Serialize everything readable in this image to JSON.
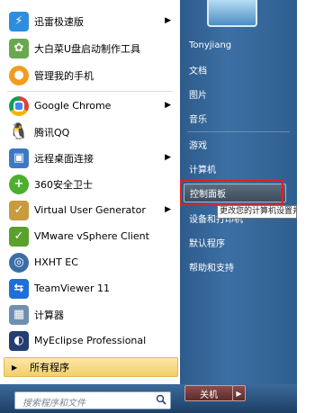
{
  "programs": [
    {
      "label": "迅雷极速版",
      "icon": "thunder-icon",
      "color": "#2e8de0",
      "arrow": true
    },
    {
      "label": "大白菜U盘启动制作工具",
      "icon": "cabbage-icon",
      "color": "#6aa84f",
      "arrow": false
    },
    {
      "label": "管理我的手机",
      "icon": "phone-manager-icon",
      "color": "#f29b1d",
      "arrow": false
    },
    {
      "label": "Google Chrome",
      "icon": "chrome-icon",
      "color": "#db4437",
      "arrow": true
    },
    {
      "label": "腾讯QQ",
      "icon": "qq-penguin-icon",
      "color": "#222222",
      "arrow": false
    },
    {
      "label": "远程桌面连接",
      "icon": "remote-desktop-icon",
      "color": "#3d78c4",
      "arrow": true
    },
    {
      "label": "360安全卫士",
      "icon": "360-icon",
      "color": "#4caf2e",
      "arrow": false
    },
    {
      "label": "Virtual User Generator",
      "icon": "vugen-icon",
      "color": "#c89b3c",
      "arrow": true
    },
    {
      "label": "VMware vSphere Client",
      "icon": "vmware-icon",
      "color": "#5aa02c",
      "arrow": false
    },
    {
      "label": "HXHT EC",
      "icon": "hxht-icon",
      "color": "#3a6ea5",
      "arrow": false
    },
    {
      "label": "TeamViewer 11",
      "icon": "teamviewer-icon",
      "color": "#1e6fd9",
      "arrow": false
    },
    {
      "label": "计算器",
      "icon": "calculator-icon",
      "color": "#6f8fb0",
      "arrow": false
    },
    {
      "label": "MyEclipse Professional",
      "icon": "myeclipse-icon",
      "color": "#243d72",
      "arrow": false
    }
  ],
  "all_programs": "所有程序",
  "search_placeholder": "搜索程序和文件",
  "right_items": [
    {
      "label": "Tonyjiang"
    },
    {
      "label": "文档"
    },
    {
      "label": "图片"
    },
    {
      "label": "音乐"
    },
    {
      "label": "游戏"
    },
    {
      "label": "计算机"
    },
    {
      "label": "控制面板"
    },
    {
      "label": "设备和打印机"
    },
    {
      "label": "默认程序"
    },
    {
      "label": "帮助和支持"
    }
  ],
  "tooltip": "更改您的计算机设置并自定义其",
  "shutdown_label": "关机"
}
